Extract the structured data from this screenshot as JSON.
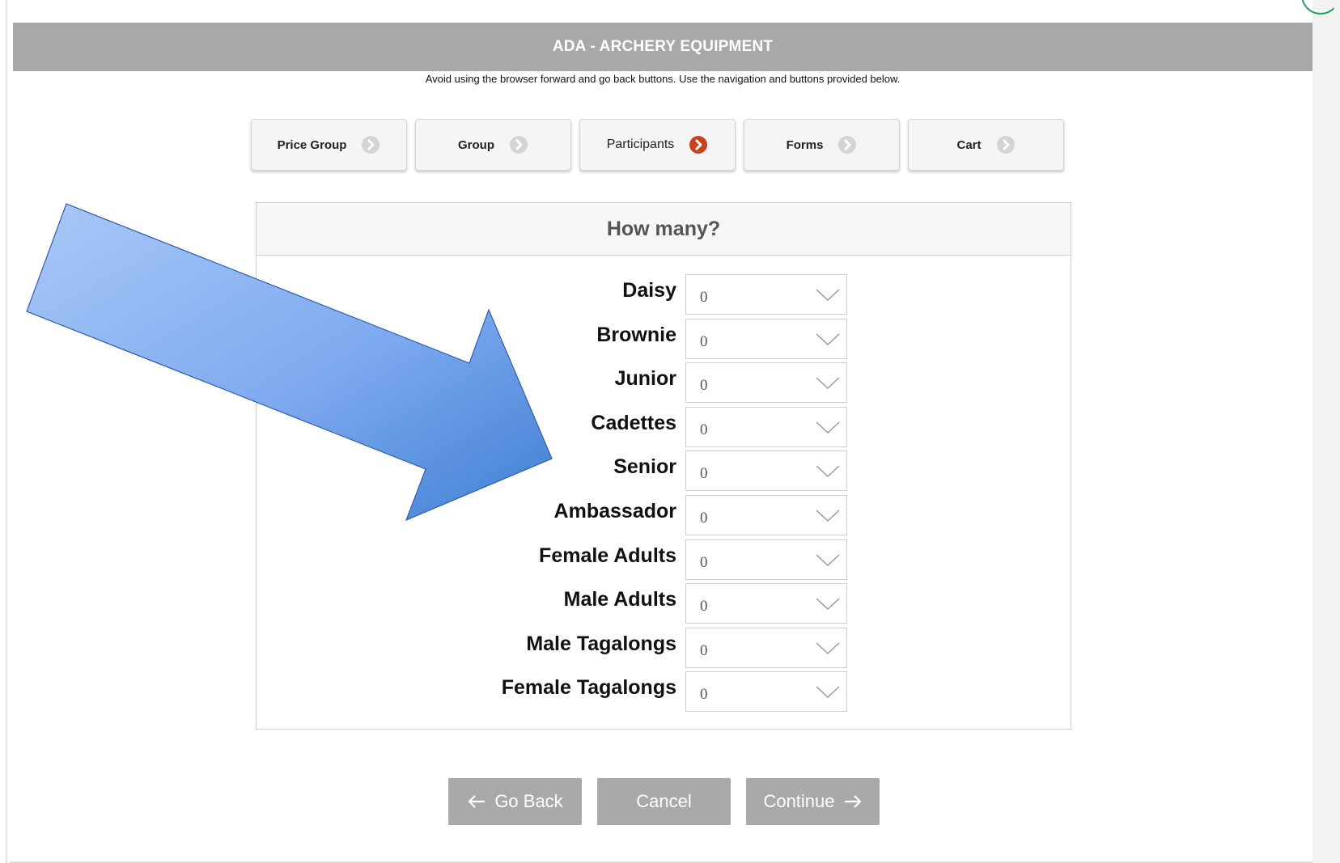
{
  "header": {
    "title": "ADA - ARCHERY EQUIPMENT"
  },
  "notice": "Avoid using the browser forward and go back buttons. Use the navigation and buttons provided below.",
  "steps": [
    {
      "label": "Price Group",
      "state": "inactive"
    },
    {
      "label": "Group",
      "state": "inactive"
    },
    {
      "label": "Participants",
      "state": "active"
    },
    {
      "label": "Forms",
      "state": "inactive"
    },
    {
      "label": "Cart",
      "state": "inactive"
    }
  ],
  "panel": {
    "title": "How many?",
    "rows": [
      {
        "label": "Daisy",
        "value": "0"
      },
      {
        "label": "Brownie",
        "value": "0"
      },
      {
        "label": "Junior",
        "value": "0"
      },
      {
        "label": "Cadettes",
        "value": "0"
      },
      {
        "label": "Senior",
        "value": "0"
      },
      {
        "label": "Ambassador",
        "value": "0"
      },
      {
        "label": "Female Adults",
        "value": "0"
      },
      {
        "label": "Male Adults",
        "value": "0"
      },
      {
        "label": "Male Tagalongs",
        "value": "0"
      },
      {
        "label": "Female Tagalongs",
        "value": "0"
      }
    ]
  },
  "buttons": {
    "back_label": "Go Back",
    "cancel_label": "Cancel",
    "continue_label": "Continue"
  },
  "icons": {
    "step_inactive": "chevron-circle-right-icon",
    "step_active": "chevron-circle-right-icon",
    "back": "arrow-left-icon",
    "continue": "arrow-right-icon",
    "dropdown": "chevron-down-icon"
  },
  "colors": {
    "header_bg": "#a8a8a8",
    "button_bg": "#a9a9a9",
    "active_step_icon": "#c8431c",
    "inactive_step_icon": "#d4d4d4",
    "annotation_arrow": "#6a9ee8"
  }
}
